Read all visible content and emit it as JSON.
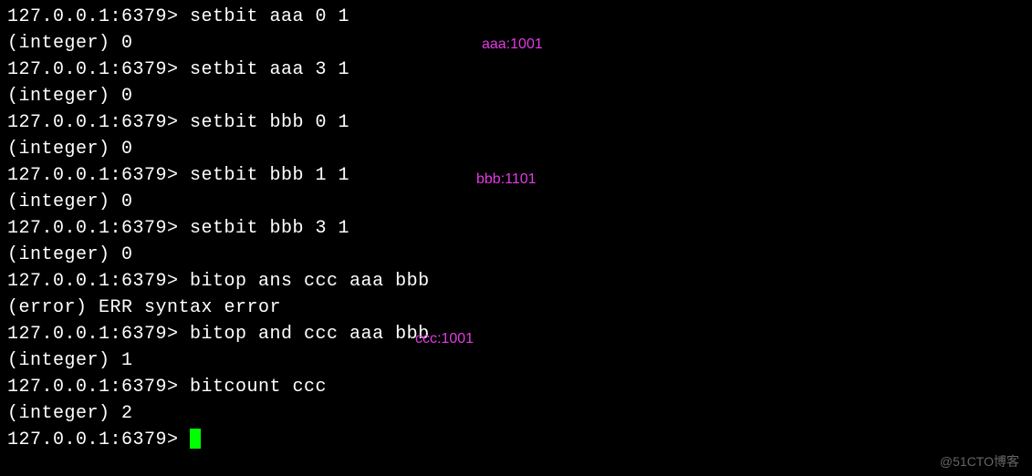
{
  "prompt": "127.0.0.1:6379> ",
  "lines": {
    "cmd1": "setbit aaa 0 1",
    "resp1": "(integer) 0",
    "cmd2": "setbit aaa 3 1",
    "resp2": "(integer) 0",
    "cmd3": "setbit bbb 0 1",
    "resp3": "(integer) 0",
    "cmd4": "setbit bbb 1 1",
    "resp4": "(integer) 0",
    "cmd5": "setbit bbb 3 1",
    "resp5": "(integer) 0",
    "cmd6": "bitop ans ccc aaa bbb",
    "resp6": "(error) ERR syntax error",
    "cmd7": "bitop and ccc aaa bbb",
    "resp7": "(integer) 1",
    "cmd8": "bitcount ccc",
    "resp8": "(integer) 2",
    "cmd9": ""
  },
  "annotations": {
    "a1": "aaa:1001",
    "a2": "bbb:1101",
    "a3": "ccc:1001"
  },
  "watermark": "@51CTO博客"
}
